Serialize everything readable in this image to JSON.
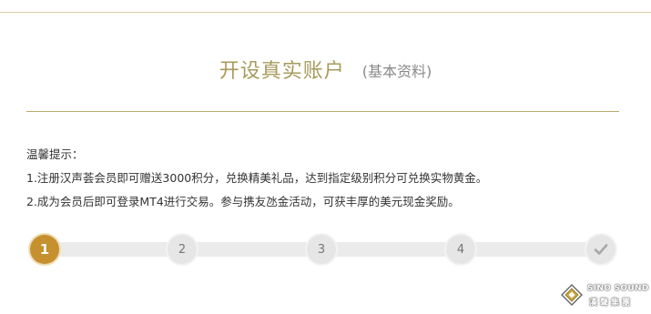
{
  "header": {
    "title": "开设真实账户",
    "subtitle": "(基本资料)"
  },
  "notice": {
    "heading": "温馨提示：",
    "lines": [
      "1.注册汉声荟会员即可赠送3000积分，兑换精美礼品，达到指定级别积分可兑换实物黄金。",
      "2.成为会员后即可登录MT4进行交易。参与携友氹金活动，可获丰厚的美元现金奖励。"
    ]
  },
  "steps": {
    "current": 1,
    "items": [
      {
        "label": "1",
        "state": "active"
      },
      {
        "label": "2",
        "state": "pending"
      },
      {
        "label": "3",
        "state": "pending"
      },
      {
        "label": "4",
        "state": "pending"
      },
      {
        "label": "",
        "icon": "check-icon",
        "state": "pending"
      }
    ]
  },
  "watermark": {
    "line1": "SINO SOUND",
    "line2": "漢聲集團"
  },
  "colors": {
    "accent_gold": "#c6902f",
    "title_gold": "#a89a5c",
    "rule": "#b8aa6e",
    "step_inactive": "#e6e6e6"
  }
}
